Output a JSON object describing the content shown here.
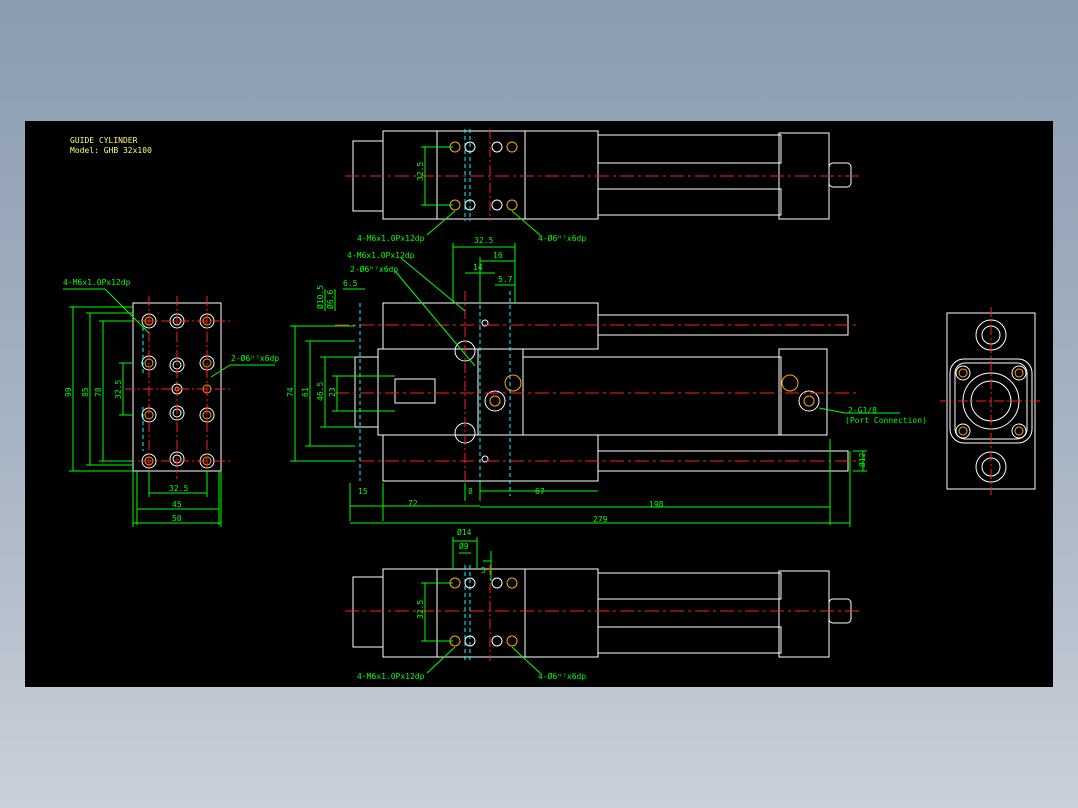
{
  "title_block": {
    "line1": "GUIDE CYLINDER",
    "line2": "Model: GHB 32x100"
  },
  "colors": {
    "background": "#000000",
    "outline": "#ffffff",
    "dimension": "#00ff00",
    "centerline": "#ff2020",
    "hidden": "#00ffff",
    "title": "#ffff66",
    "hole": "#ffa500",
    "frame_outer": "#8a9cb0"
  },
  "top_view": {
    "callout_tap": "4-M6x1.0Px12dp",
    "callout_pin": "4-Ø6ᴴ⁷x6dp",
    "dim_32_5": "32.5"
  },
  "front_view": {
    "callout_tap": "4-M6x1.0Px12dp",
    "callout_pin": "2-Ø6ᴴ⁷x6dp",
    "callout_port": "2-G1/8",
    "port_note": "(Port Connection)",
    "dims": {
      "d32_5": "32.5",
      "d16": "16",
      "d14": "14",
      "d5_7": "5.7",
      "d10_5": "Ø10.5",
      "d6_6": "Ø6.6",
      "d6_5": "6.5",
      "d74": "74",
      "d61": "61",
      "d46_5": "46.5",
      "d23": "23",
      "d15": "15",
      "d8": "8",
      "d67": "67",
      "d72": "72",
      "d198": "198",
      "d279": "279",
      "d12": "Ø12"
    }
  },
  "side_view": {
    "callout_tap": "4-M6x1.0Px12dp",
    "callout_pin": "2-Ø6ᴴ⁷x6dp",
    "dims": {
      "d99": "99",
      "d85": "85",
      "d78": "78",
      "d32_5v": "32.5",
      "d32_5h": "32.5",
      "d45": "45",
      "d50": "50"
    }
  },
  "bottom_view": {
    "callout_tap": "4-M6x1.0Px12dp",
    "callout_pin": "4-Ø6ᴴ⁷x6dp",
    "dim_14": "Ø14",
    "dim_9": "Ø9",
    "dim_5": "5",
    "dim_32_5": "32.5"
  }
}
